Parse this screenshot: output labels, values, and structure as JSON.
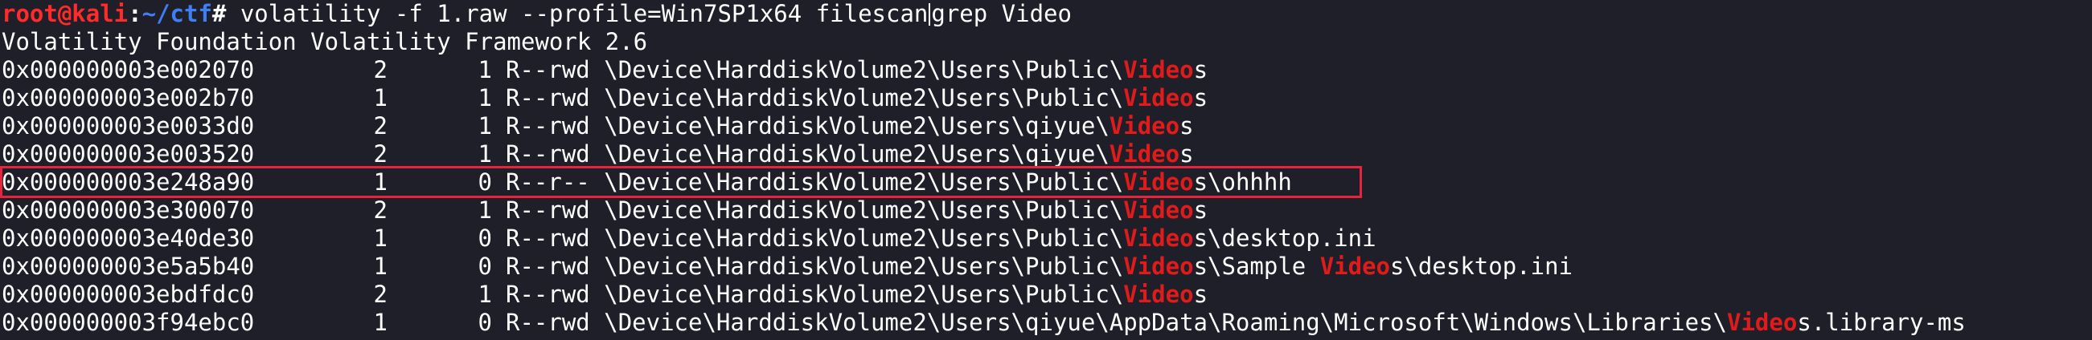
{
  "prompt": {
    "user_host": "root@kali",
    "separator": ":",
    "path": "~/ctf",
    "symbol": "#",
    "command_before_pipe": " volatility -f 1.raw --profile=Win7SP1x64 filescan",
    "command_after_pipe": "grep Video"
  },
  "banner": "Volatility Foundation Volatility Framework 2.6",
  "highlight_color": "#e8233c",
  "match_color": "#e01b1b",
  "rows": [
    {
      "offset": "0x000000003e002070",
      "ptr": "2",
      "hnd": "1",
      "access": "R--rwd",
      "path_before": "\\Device\\HarddiskVolume2\\Users\\Public\\",
      "match": "Video",
      "path_after": "s"
    },
    {
      "offset": "0x000000003e002b70",
      "ptr": "1",
      "hnd": "1",
      "access": "R--rwd",
      "path_before": "\\Device\\HarddiskVolume2\\Users\\Public\\",
      "match": "Video",
      "path_after": "s"
    },
    {
      "offset": "0x000000003e0033d0",
      "ptr": "2",
      "hnd": "1",
      "access": "R--rwd",
      "path_before": "\\Device\\HarddiskVolume2\\Users\\qiyue\\",
      "match": "Video",
      "path_after": "s"
    },
    {
      "offset": "0x000000003e003520",
      "ptr": "2",
      "hnd": "1",
      "access": "R--rwd",
      "path_before": "\\Device\\HarddiskVolume2\\Users\\qiyue\\",
      "match": "Video",
      "path_after": "s"
    },
    {
      "offset": "0x000000003e248a90",
      "ptr": "1",
      "hnd": "0",
      "access": "R--r--",
      "path_before": "\\Device\\HarddiskVolume2\\Users\\Public\\",
      "match": "Video",
      "path_after": "s\\ohhhh"
    },
    {
      "offset": "0x000000003e300070",
      "ptr": "2",
      "hnd": "1",
      "access": "R--rwd",
      "path_before": "\\Device\\HarddiskVolume2\\Users\\Public\\",
      "match": "Video",
      "path_after": "s"
    },
    {
      "offset": "0x000000003e40de30",
      "ptr": "1",
      "hnd": "0",
      "access": "R--rwd",
      "path_before": "\\Device\\HarddiskVolume2\\Users\\Public\\",
      "match": "Video",
      "path_after": "s\\desktop.ini"
    },
    {
      "offset": "0x000000003e5a5b40",
      "ptr": "1",
      "hnd": "0",
      "access": "R--rwd",
      "path_before": "\\Device\\HarddiskVolume2\\Users\\Public\\",
      "match": "Video",
      "path_after": "s\\Sample ",
      "match2": "Video",
      "path_after2": "s\\desktop.ini"
    },
    {
      "offset": "0x000000003ebdfdc0",
      "ptr": "2",
      "hnd": "1",
      "access": "R--rwd",
      "path_before": "\\Device\\HarddiskVolume2\\Users\\Public\\",
      "match": "Video",
      "path_after": "s"
    },
    {
      "offset": "0x000000003f94ebc0",
      "ptr": "1",
      "hnd": "0",
      "access": "R--rwd",
      "path_before": "\\Device\\HarddiskVolume2\\Users\\qiyue\\AppData\\Roaming\\Microsoft\\Windows\\Libraries\\",
      "match": "Video",
      "path_after": "s.library-ms"
    }
  ]
}
